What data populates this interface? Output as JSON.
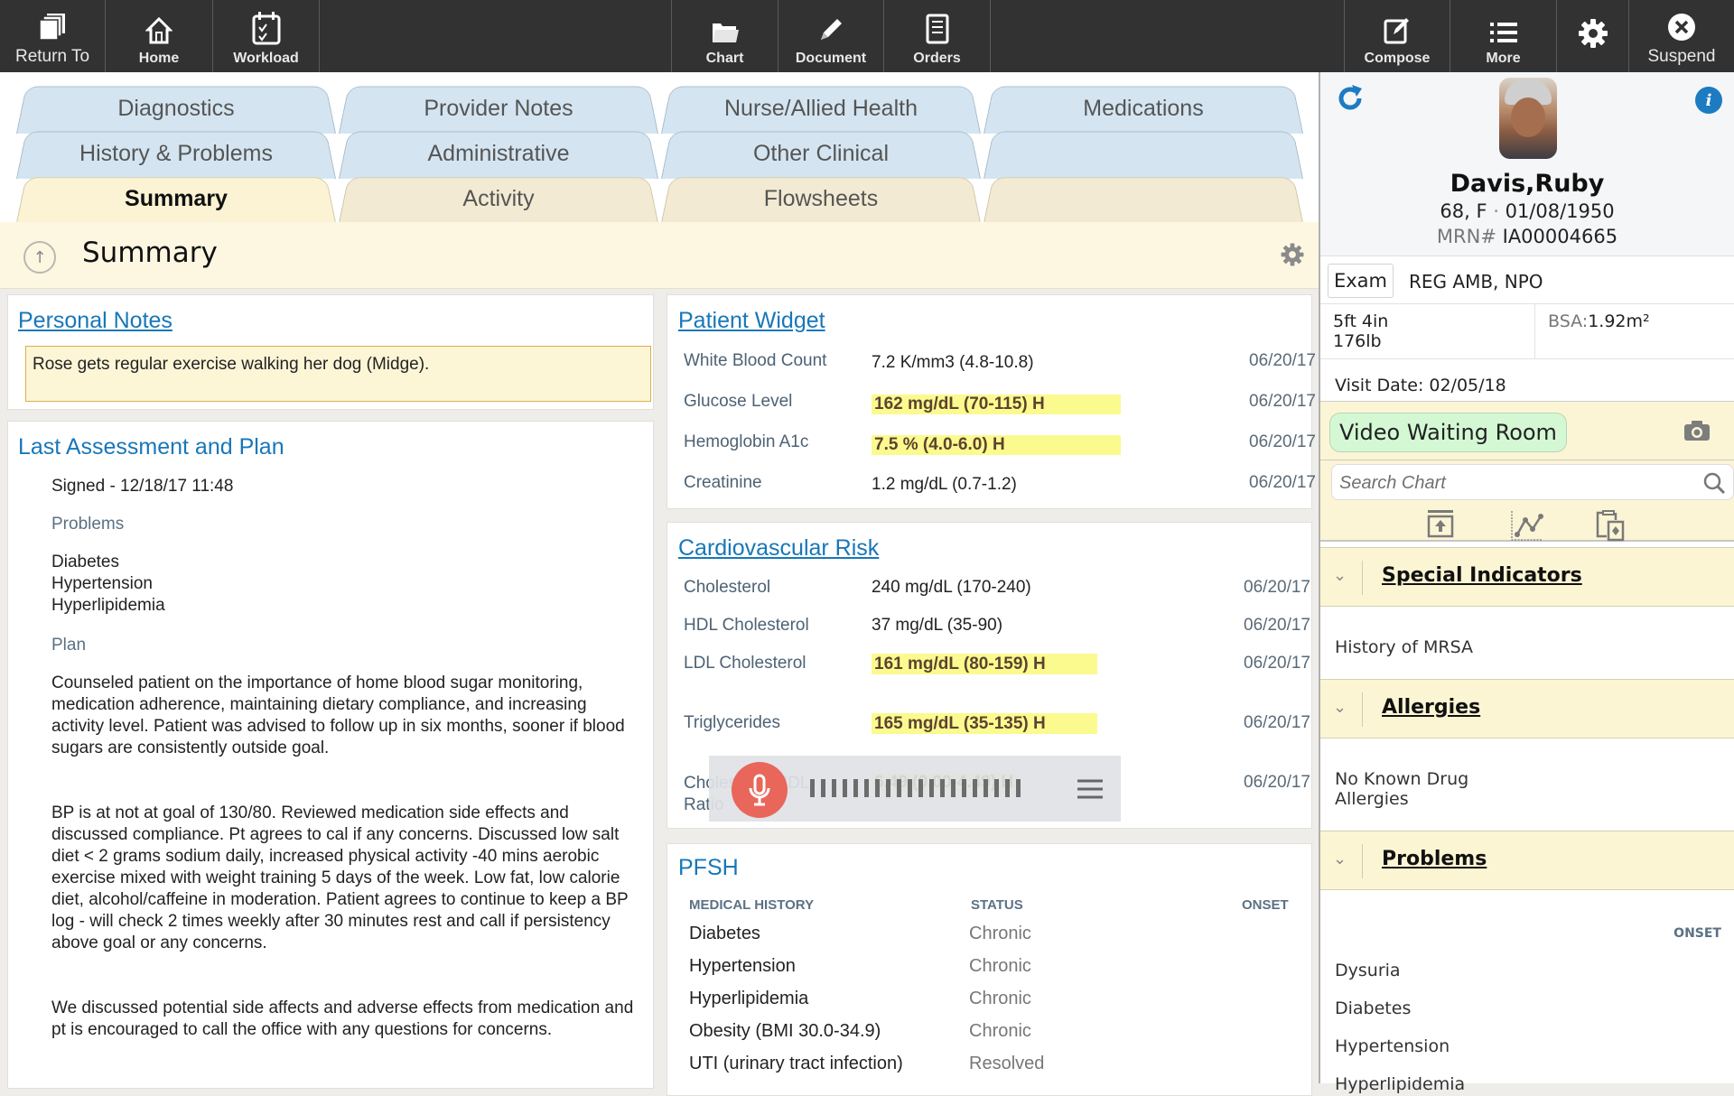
{
  "toolbar": {
    "return_to": "Return To",
    "home": "Home",
    "workload": "Workload",
    "chart": "Chart",
    "document": "Document",
    "orders": "Orders",
    "compose": "Compose",
    "more": "More",
    "suspend": "Suspend",
    "icons": [
      "stack-icon",
      "home-icon",
      "calendar-check-icon",
      "folder-icon",
      "pencil-icon",
      "orders-clipboard-icon",
      "compose-icon",
      "list-icon",
      "gear-icon",
      "close-circle-icon"
    ]
  },
  "tabs": {
    "row1": [
      "Diagnostics",
      "Provider Notes",
      "Nurse/Allied Health",
      "Medications"
    ],
    "row2": [
      "History & Problems",
      "Administrative",
      "Other Clinical",
      ""
    ],
    "row3": [
      "Summary",
      "Activity",
      "Flowsheets",
      ""
    ],
    "active": "Summary"
  },
  "summary": {
    "title": "Summary"
  },
  "personal_notes": {
    "title": "Personal Notes",
    "text": "Rose gets regular exercise walking her dog (Midge)."
  },
  "last_assessment": {
    "title": "Last Assessment and Plan",
    "signed": "Signed - 12/18/17 11:48",
    "problems_label": "Problems",
    "problems": [
      "Diabetes",
      "Hypertension",
      "Hyperlipidemia"
    ],
    "plan_label": "Plan",
    "plan_paragraphs": [
      "Counseled patient on the importance of home blood sugar monitoring, medication adherence, maintaining dietary compliance, and increasing activity level. Patient was advised to follow up in six months, sooner if blood sugars are consistently outside goal.",
      "BP is at not at goal of 130/80. Reviewed medication side effects and discussed compliance. Pt agrees to cal if any concerns. Discussed low salt diet < 2 grams sodium daily, increased physical activity -40 mins aerobic exercise mixed with weight training 5 days of the week. Low fat, low calorie diet, alcohol/caffeine in moderation. Patient agrees to continue to keep a BP log - will check 2 times weekly after 30 minutes rest and call if persistency above goal or any concerns.",
      "We discussed potential side affects and adverse effects from medication and pt is encouraged to call the office with any questions for concerns."
    ]
  },
  "patient_widget": {
    "title": "Patient Widget",
    "rows": [
      {
        "name": "White Blood Count",
        "value": "7.2 K/mm3 (4.8-10.8)",
        "date": "06/20/17",
        "high": false
      },
      {
        "name": "Glucose Level",
        "value": "162 mg/dL (70-115) H",
        "date": "06/20/17",
        "high": true
      },
      {
        "name": "Hemoglobin A1c",
        "value": "7.5 % (4.0-6.0) H",
        "date": "06/20/17",
        "high": true
      },
      {
        "name": "Creatinine",
        "value": "1.2 mg/dL (0.7-1.2)",
        "date": "06/20/17",
        "high": false
      }
    ]
  },
  "cardio_risk": {
    "title": "Cardiovascular Risk",
    "rows": [
      {
        "name": "Cholesterol",
        "value": "240 mg/dL (170-240)",
        "date": "06/20/17",
        "high": false
      },
      {
        "name": "HDL Cholesterol",
        "value": "37 mg/dL (35-90)",
        "date": "06/20/17",
        "high": false
      },
      {
        "name": "LDL Cholesterol",
        "value": "161 mg/dL (80-159) H",
        "date": "06/20/17",
        "high": true
      },
      {
        "name": "Triglycerides",
        "value": "165 mg/dL (35-135) H",
        "date": "06/20/17",
        "high": true
      },
      {
        "name": "Cholesterol/HDL Ratio",
        "value": "6.49 (0.00-4.49) H",
        "date": "06/20/17",
        "high": true
      }
    ]
  },
  "pfsh": {
    "title": "PFSH",
    "col_history": "MEDICAL HISTORY",
    "col_status": "STATUS",
    "col_onset": "ONSET",
    "rows": [
      {
        "name": "Diabetes",
        "status": "Chronic"
      },
      {
        "name": "Hypertension",
        "status": "Chronic"
      },
      {
        "name": "Hyperlipidemia",
        "status": "Chronic"
      },
      {
        "name": "Obesity (BMI 30.0-34.9)",
        "status": "Chronic"
      },
      {
        "name": "UTI (urinary tract infection)",
        "status": "Resolved"
      }
    ]
  },
  "voice_overlay": {
    "icons": [
      "microphone-icon",
      "waveform-icon",
      "menu-icon"
    ]
  },
  "patient": {
    "name": "Davis,Ruby",
    "age_sex": "68, F",
    "dob": "01/08/1950",
    "mrn_label": "MRN#",
    "mrn": "IA00004665",
    "exam_label": "Exam",
    "exam_value": "REG AMB, NPO",
    "height": "5ft 4in",
    "weight": "176lb",
    "bsa_label": "BSA:",
    "bsa": "1.92m²",
    "visit_date": "Visit Date: 02/05/18"
  },
  "sidebar": {
    "video_waiting_room": "Video Waiting Room",
    "search_placeholder": "Search Chart",
    "special_indicators": {
      "title": "Special Indicators",
      "items": [
        "History of MRSA"
      ]
    },
    "allergies": {
      "title": "Allergies",
      "items": [
        "No Known Drug Allergies"
      ]
    },
    "problems": {
      "title": "Problems",
      "onset_label": "ONSET",
      "items": [
        "Dysuria",
        "Diabetes",
        "Hypertension",
        "Hyperlipidemia"
      ]
    }
  }
}
